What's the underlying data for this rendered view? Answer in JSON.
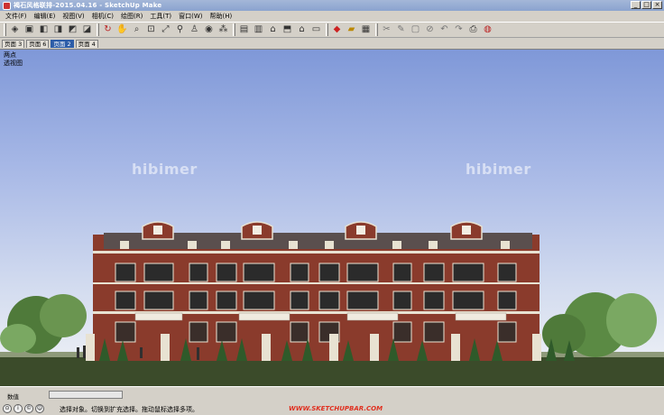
{
  "window": {
    "title": "褐石风格联排-2015.04.16 - SketchUp Make",
    "minimize": "_",
    "maximize": "□",
    "close": "×"
  },
  "menu": [
    {
      "label": "文件(F)"
    },
    {
      "label": "编辑(E)"
    },
    {
      "label": "视图(V)"
    },
    {
      "label": "相机(C)"
    },
    {
      "label": "绘图(R)"
    },
    {
      "label": "工具(T)"
    },
    {
      "label": "窗口(W)"
    },
    {
      "label": "帮助(H)"
    }
  ],
  "toolbar_icons": [
    "iso-view-icon",
    "top-view-icon",
    "front-view-icon",
    "right-view-icon",
    "back-view-icon",
    "left-view-icon",
    "orbit-icon",
    "pan-icon",
    "zoom-icon",
    "zoom-window-icon",
    "zoom-extents-icon",
    "position-camera-icon",
    "walk-icon",
    "look-around-icon",
    "footprints-icon",
    "warehouse-icon",
    "components-icon",
    "house-icon",
    "share-model-icon",
    "building-icon",
    "extension-icon",
    "section-icon",
    "section-display-icon",
    "save-icon",
    "move-icon",
    "rotate-icon",
    "offset-icon",
    "erase-icon",
    "undo-icon",
    "redo-icon",
    "print-icon",
    "layout-icon"
  ],
  "tabs": [
    {
      "label": "页面 3",
      "active": false
    },
    {
      "label": "页面 6",
      "active": false
    },
    {
      "label": "页面 2",
      "active": true
    },
    {
      "label": "页面 4",
      "active": false
    }
  ],
  "viewport": {
    "label_line1": "两点",
    "label_line2": "透视图",
    "watermark": "hibimer"
  },
  "statusbar": {
    "measure_label": "数值",
    "status_text": "选择对象。切换到扩充选择。拖动鼠标选择多项。",
    "site_credit": "WWW.SKETCHUPBAR.COM"
  }
}
